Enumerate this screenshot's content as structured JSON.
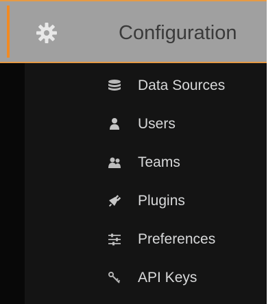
{
  "header": {
    "title": "Configuration",
    "icon": "gear-icon"
  },
  "menu": {
    "items": [
      {
        "label": "Data Sources",
        "icon": "database-icon"
      },
      {
        "label": "Users",
        "icon": "user-icon"
      },
      {
        "label": "Teams",
        "icon": "users-group-icon"
      },
      {
        "label": "Plugins",
        "icon": "plug-icon"
      },
      {
        "label": "Preferences",
        "icon": "sliders-icon"
      },
      {
        "label": "API Keys",
        "icon": "key-icon"
      }
    ]
  },
  "colors": {
    "panel_bg": "#141414",
    "header_bg": "#a0a0a0",
    "accent": "#f08a24",
    "menu_text": "#d8d9da",
    "header_text": "#3a3a3a"
  }
}
